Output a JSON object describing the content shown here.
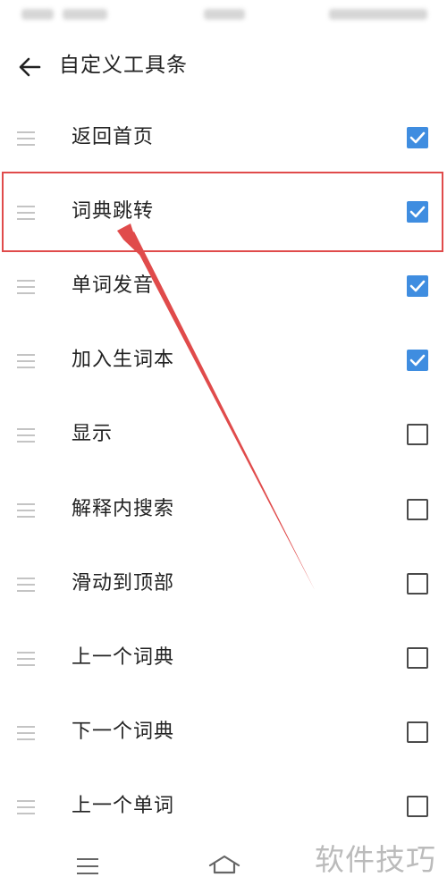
{
  "header": {
    "title": "自定义工具条"
  },
  "items": [
    {
      "label": "返回首页",
      "checked": true
    },
    {
      "label": "词典跳转",
      "checked": true
    },
    {
      "label": "单词发音",
      "checked": true
    },
    {
      "label": "加入生词本",
      "checked": true
    },
    {
      "label": "显示",
      "checked": false
    },
    {
      "label": "解释内搜索",
      "checked": false
    },
    {
      "label": "滑动到顶部",
      "checked": false
    },
    {
      "label": "上一个词典",
      "checked": false
    },
    {
      "label": "下一个词典",
      "checked": false
    },
    {
      "label": "上一个单词",
      "checked": false
    }
  ],
  "watermark": "软件技巧",
  "colors": {
    "checkbox_on": "#3f8de0",
    "annotation": "#e04b4b"
  },
  "icons": {
    "back": "arrow-left-icon",
    "drag": "drag-handle-icon",
    "nav_menu": "menu-icon",
    "nav_home": "home-icon"
  }
}
